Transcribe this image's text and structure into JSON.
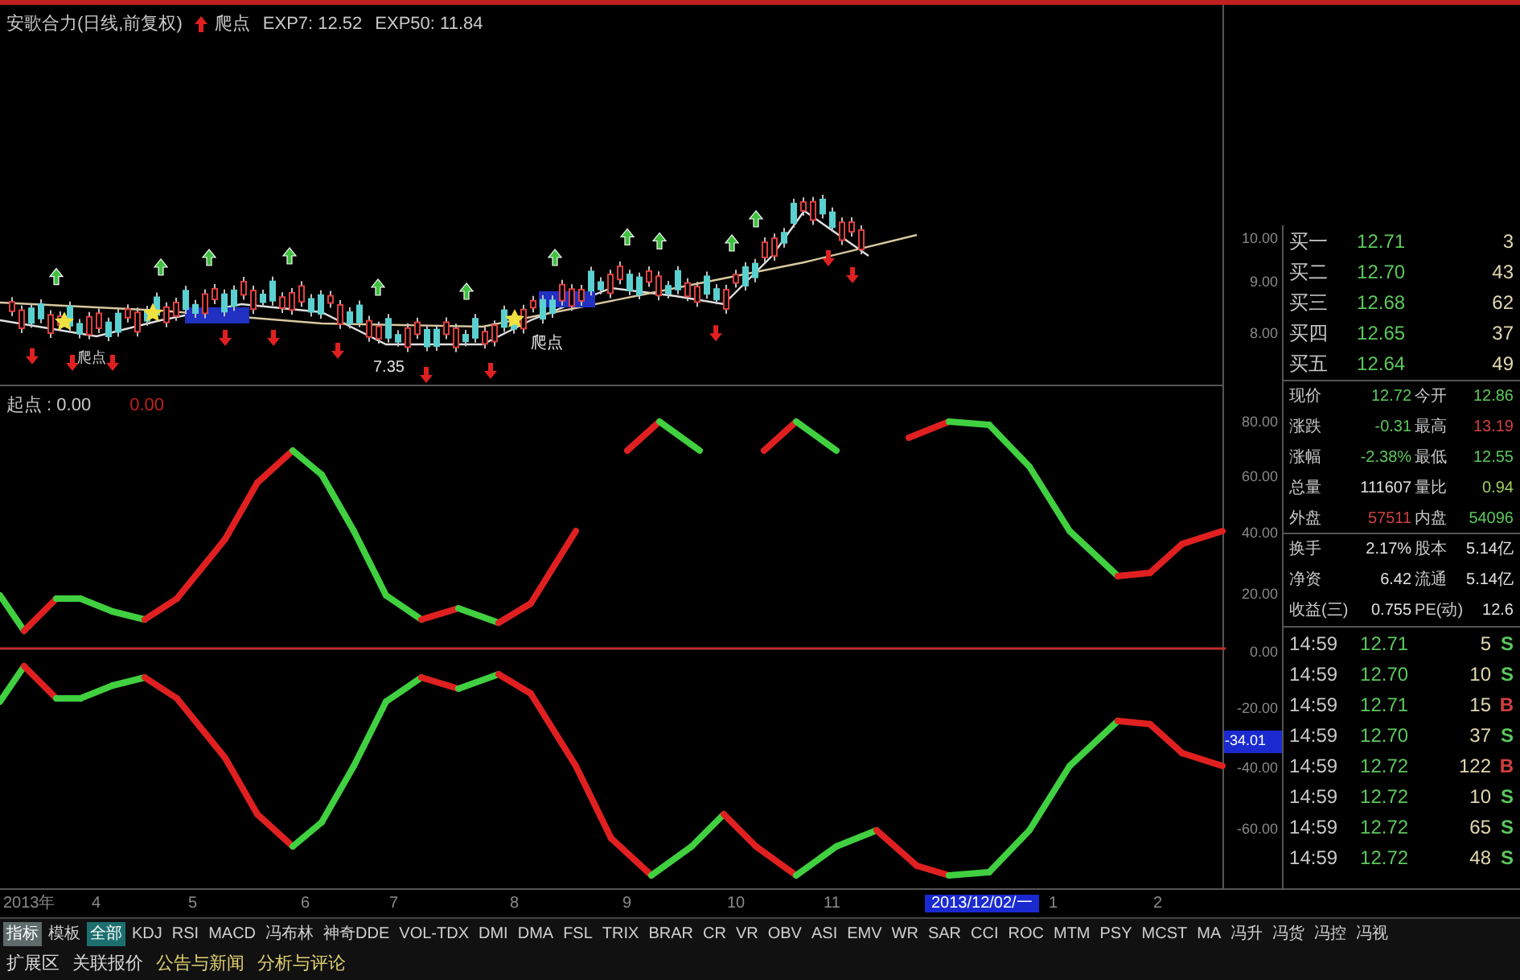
{
  "price_chart": {
    "title": "安歌合力(日线,前复权)",
    "signal": "爬点",
    "exp7": "EXP7: 12.52",
    "exp50": "EXP50: 11.84",
    "labels": [
      "爬点",
      "爬点",
      "7.35"
    ],
    "axis": [
      "10.00",
      "9.00",
      "8.00"
    ]
  },
  "indicator": {
    "name": "起点 : 0.00",
    "value": "0.00",
    "axis": [
      "80.00",
      "60.00",
      "40.00",
      "20.00",
      "0.00",
      "-20.00",
      "-40.00",
      "-60.00"
    ],
    "cursor_value": "-34.01"
  },
  "order_book": [
    {
      "label": "买一",
      "price": "12.71",
      "volume": "3"
    },
    {
      "label": "买二",
      "price": "12.70",
      "volume": "43"
    },
    {
      "label": "买三",
      "price": "12.68",
      "volume": "62"
    },
    {
      "label": "买四",
      "price": "12.65",
      "volume": "37"
    },
    {
      "label": "买五",
      "price": "12.64",
      "volume": "49"
    }
  ],
  "quote": [
    {
      "left": {
        "label": "现价",
        "value": "12.72",
        "color": "#5cc85c"
      },
      "right": {
        "label": "今开",
        "value": "12.86",
        "color": "#5cc85c"
      }
    },
    {
      "left": {
        "label": "涨跌",
        "value": "-0.31",
        "color": "#5cc85c"
      },
      "right": {
        "label": "最高",
        "value": "13.19",
        "color": "#d04040"
      }
    },
    {
      "left": {
        "label": "涨幅",
        "value": "-2.38%",
        "color": "#5cc85c"
      },
      "right": {
        "label": "最低",
        "value": "12.55",
        "color": "#5cc85c"
      }
    },
    {
      "left": {
        "label": "总量",
        "value": "111607",
        "color": "#e0e0e0"
      },
      "right": {
        "label": "量比",
        "value": "0.94",
        "color": "#9fd05c"
      }
    },
    {
      "left": {
        "label": "外盘",
        "value": "57511",
        "color": "#d04040"
      },
      "right": {
        "label": "内盘",
        "value": "54096",
        "color": "#5cc85c"
      }
    },
    {
      "left": {
        "label": "换手",
        "value": "2.17%",
        "color": "#e0e0e0"
      },
      "right": {
        "label": "股本",
        "value": "5.14亿",
        "color": "#e0e0e0"
      }
    },
    {
      "left": {
        "label": "净资",
        "value": "6.42",
        "color": "#e0e0e0"
      },
      "right": {
        "label": "流通",
        "value": "5.14亿",
        "color": "#e0e0e0"
      }
    },
    {
      "left": {
        "label": "收益(三)",
        "value": "0.755",
        "color": "#e0e0e0"
      },
      "right": {
        "label": "PE(动)",
        "value": "12.6",
        "color": "#e0e0e0"
      }
    }
  ],
  "ticks": [
    {
      "time": "14:59",
      "price": "12.71",
      "volume": "5",
      "side": "S",
      "color": "#5cc85c"
    },
    {
      "time": "14:59",
      "price": "12.70",
      "volume": "10",
      "side": "S",
      "color": "#5cc85c"
    },
    {
      "time": "14:59",
      "price": "12.71",
      "volume": "15",
      "side": "B",
      "color": "#d04040"
    },
    {
      "time": "14:59",
      "price": "12.70",
      "volume": "37",
      "side": "S",
      "color": "#5cc85c"
    },
    {
      "time": "14:59",
      "price": "12.72",
      "volume": "122",
      "side": "B",
      "color": "#d04040"
    },
    {
      "time": "14:59",
      "price": "12.72",
      "volume": "10",
      "side": "S",
      "color": "#5cc85c"
    },
    {
      "time": "14:59",
      "price": "12.72",
      "volume": "65",
      "side": "S",
      "color": "#5cc85c"
    },
    {
      "time": "14:59",
      "price": "12.72",
      "volume": "48",
      "side": "S",
      "color": "#5cc85c"
    }
  ],
  "time_axis": [
    {
      "label": "2013年",
      "selected": false
    },
    {
      "label": "4",
      "selected": false
    },
    {
      "label": "5",
      "selected": false
    },
    {
      "label": "6",
      "selected": false
    },
    {
      "label": "7",
      "selected": false
    },
    {
      "label": "8",
      "selected": false
    },
    {
      "label": "9",
      "selected": false
    },
    {
      "label": "10",
      "selected": false
    },
    {
      "label": "11",
      "selected": false
    },
    {
      "label": "2013/12/02/一",
      "selected": true
    },
    {
      "label": "1",
      "selected": false
    },
    {
      "label": "2",
      "selected": false
    }
  ],
  "tabs": [
    {
      "label": "指标",
      "selected": true,
      "color": "#5f6b6b"
    },
    {
      "label": "模板",
      "selected": false
    },
    {
      "label": "全部",
      "selected": true,
      "color": "#1d6f6f"
    },
    {
      "label": "KDJ",
      "selected": false
    },
    {
      "label": "RSI",
      "selected": false
    },
    {
      "label": "MACD",
      "selected": false
    },
    {
      "label": "冯布林",
      "selected": false
    },
    {
      "label": "神奇DDE",
      "selected": false
    },
    {
      "label": "VOL-TDX",
      "selected": false
    },
    {
      "label": "DMI",
      "selected": false
    },
    {
      "label": "DMA",
      "selected": false
    },
    {
      "label": "FSL",
      "selected": false
    },
    {
      "label": "TRIX",
      "selected": false
    },
    {
      "label": "BRAR",
      "selected": false
    },
    {
      "label": "CR",
      "selected": false
    },
    {
      "label": "VR",
      "selected": false
    },
    {
      "label": "OBV",
      "selected": false
    },
    {
      "label": "ASI",
      "selected": false
    },
    {
      "label": "EMV",
      "selected": false
    },
    {
      "label": "WR",
      "selected": false
    },
    {
      "label": "SAR",
      "selected": false
    },
    {
      "label": "CCI",
      "selected": false
    },
    {
      "label": "ROC",
      "selected": false
    },
    {
      "label": "MTM",
      "selected": false
    },
    {
      "label": "PSY",
      "selected": false
    },
    {
      "label": "MCST",
      "selected": false
    },
    {
      "label": "MA",
      "selected": false
    },
    {
      "label": "冯升",
      "selected": false
    },
    {
      "label": "冯货",
      "selected": false
    },
    {
      "label": "冯控",
      "selected": false
    },
    {
      "label": "冯视",
      "selected": false
    }
  ],
  "tabs2": [
    {
      "label": "扩展区",
      "color": "#d8d8d8"
    },
    {
      "label": "关联报价",
      "color": "#d8d8d8"
    },
    {
      "label": "公告与新闻",
      "color": "#e0d070"
    },
    {
      "label": "分析与评论",
      "color": "#e0d070"
    }
  ]
}
